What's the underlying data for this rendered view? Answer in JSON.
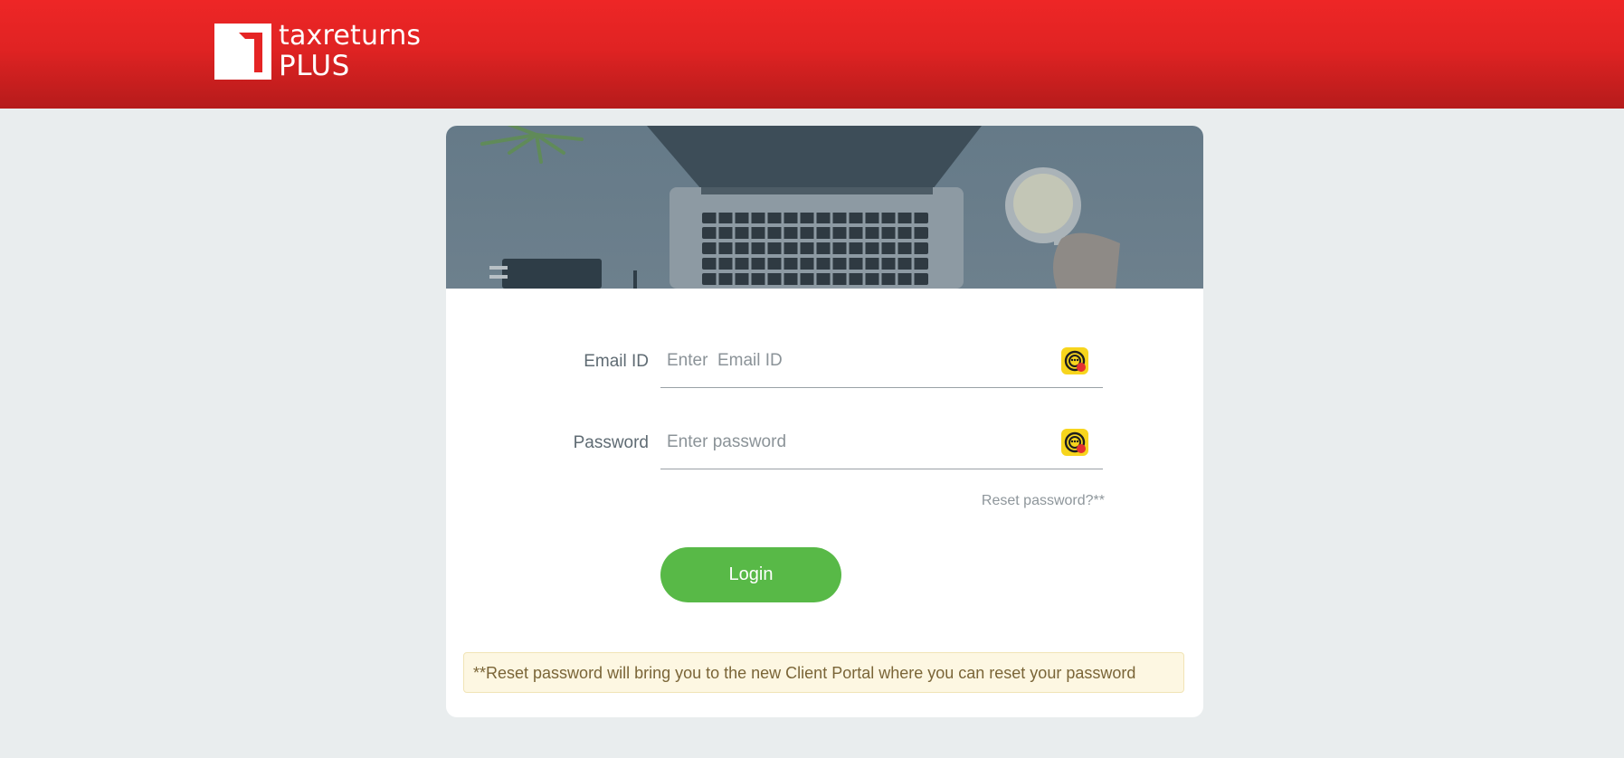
{
  "header": {
    "logo_line1": "taxreturns",
    "logo_line2": "PLUS",
    "brand_color": "#e52424"
  },
  "form": {
    "email": {
      "label": "Email ID",
      "placeholder": "Enter  Email ID",
      "value": "",
      "icon": "password-manager-icon"
    },
    "password": {
      "label": "Password",
      "placeholder": "Enter password",
      "value": "",
      "icon": "password-manager-icon"
    },
    "reset_link": "Reset password?**",
    "login_button": "Login",
    "login_color": "#58b947"
  },
  "notice": {
    "text": "**Reset password will bring you to the new Client Portal where you can reset your password"
  }
}
